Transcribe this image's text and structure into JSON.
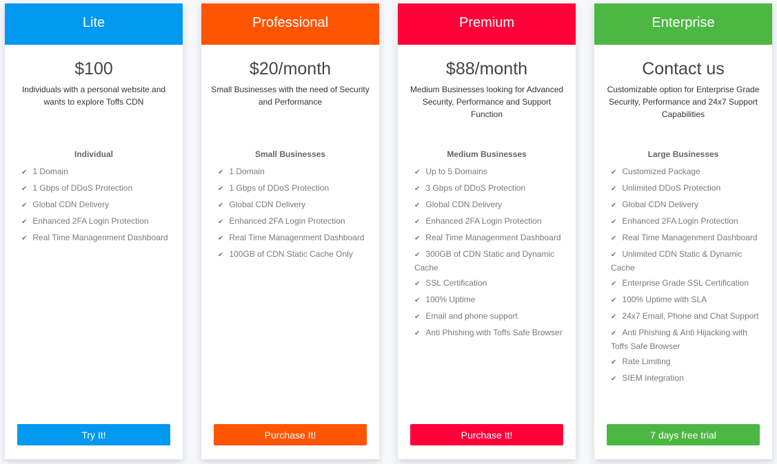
{
  "plans": [
    {
      "name": "Lite",
      "color": "#0099ef",
      "price": "$100",
      "description": "Individuals with a personal website and wants to explore Toffs CDN",
      "tier": "Individual",
      "features": [
        "1 Domain",
        "1 Gbps of DDoS Protection",
        "Global CDN Delivery",
        "Enhanced 2FA Login Protection",
        "Real Time Managenment Dashboard"
      ],
      "button": "Try It!"
    },
    {
      "name": "Professional",
      "color": "#ff5500",
      "price": "$20/month",
      "description": "Small Businesses with the need of Security and Performance",
      "tier": "Small Businesses",
      "features": [
        "1 Domain",
        "1 Gbps of DDoS Protection",
        "Global CDN Delivery",
        "Enhanced 2FA Login Protection",
        "Real Time Managenment Dashboard",
        "100GB of CDN Static Cache Only"
      ],
      "button": "Purchase It!"
    },
    {
      "name": "Premium",
      "color": "#ff0038",
      "price": "$88/month",
      "description": "Medium Businesses looking for Advanced Security, Performance and Support Function",
      "tier": "Medium Businesses",
      "features": [
        "Up to 5 Domains",
        "3 Gbps of DDoS Protection",
        "Global CDN Delivery",
        "Enhanced 2FA Login Protection",
        "Real Time Managenment Dashboard",
        "300GB of CDN Static and Dynamic Cache",
        "SSL Certification",
        "100% Uptime",
        "Email and phone support",
        "Anti Phishing with Toffs Safe Browser"
      ],
      "button": "Purchase It!"
    },
    {
      "name": "Enterprise",
      "color": "#4cb843",
      "price": "Contact us",
      "description": "Customizable option for Enterprise Grade Security, Performance and 24x7 Support Capabilities",
      "tier": "Large Businesses",
      "features": [
        "Customized Package",
        "Unlimited DDoS Protection",
        "Global CDN Delivery",
        "Enhanced 2FA Login Protection",
        "Real Time Managenment Dashboard",
        "Unlimited CDN Static & Dynamic Cache",
        "Enterprise Grade SSL Certification",
        "100% Uptime with SLA",
        "24x7 Email, Phone and Chat Support",
        "Anti Phishing & Anti Hijacking with Toffs Safe Browser",
        "Rate Limiting",
        "SIEM Integration"
      ],
      "button": "7 days free trial"
    }
  ]
}
